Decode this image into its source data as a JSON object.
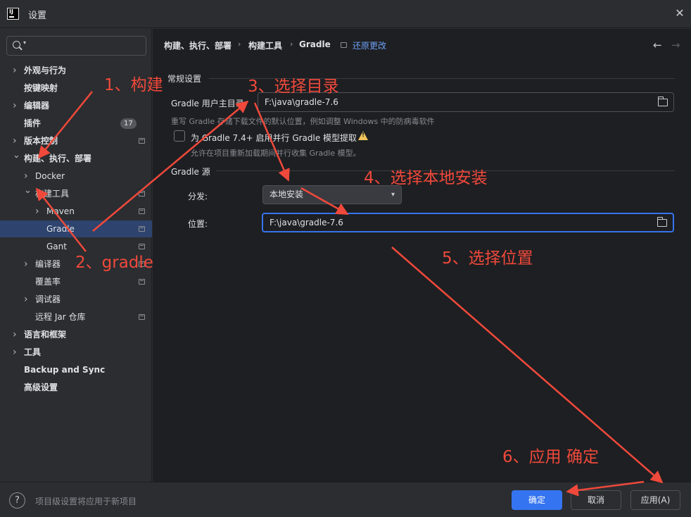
{
  "window": {
    "title": "设置",
    "app_icon_text": "IJ"
  },
  "sidebar": {
    "search": {
      "value": "",
      "placeholder": ""
    },
    "items": [
      {
        "label": "外观与行为",
        "level": 0,
        "chevron": "right",
        "bold": true,
        "proj_icon": false
      },
      {
        "label": "按键映射",
        "level": 0,
        "chevron": "none",
        "bold": true,
        "proj_icon": false
      },
      {
        "label": "编辑器",
        "level": 0,
        "chevron": "right",
        "bold": true,
        "proj_icon": false
      },
      {
        "label": "插件",
        "level": 0,
        "chevron": "none",
        "bold": true,
        "badge": "17"
      },
      {
        "label": "版本控制",
        "level": 0,
        "chevron": "right",
        "bold": true,
        "proj_icon": true
      },
      {
        "label": "构建、执行、部署",
        "level": 0,
        "chevron": "down",
        "bold": true,
        "proj_icon": false
      },
      {
        "label": "Docker",
        "level": 1,
        "chevron": "right",
        "bold": false,
        "proj_icon": false
      },
      {
        "label": "构建工具",
        "level": 1,
        "chevron": "down",
        "bold": false,
        "proj_icon": true
      },
      {
        "label": "Maven",
        "level": 2,
        "chevron": "right",
        "bold": false,
        "proj_icon": true
      },
      {
        "label": "Gradle",
        "level": 3,
        "chevron": "none",
        "bold": false,
        "proj_icon": true,
        "selected": true
      },
      {
        "label": "Gant",
        "level": 3,
        "chevron": "none",
        "bold": false,
        "proj_icon": true
      },
      {
        "label": "编译器",
        "level": 1,
        "chevron": "right",
        "bold": false,
        "proj_icon": true
      },
      {
        "label": "覆盖率",
        "level": 1.5,
        "chevron": "none",
        "bold": false,
        "proj_icon": true
      },
      {
        "label": "调试器",
        "level": 1,
        "chevron": "right",
        "bold": false,
        "proj_icon": false
      },
      {
        "label": "远程 Jar 仓库",
        "level": 1.5,
        "chevron": "none",
        "bold": false,
        "proj_icon": true
      },
      {
        "label": "语言和框架",
        "level": 0,
        "chevron": "right",
        "bold": true,
        "proj_icon": false
      },
      {
        "label": "工具",
        "level": 0,
        "chevron": "right",
        "bold": true,
        "proj_icon": false
      },
      {
        "label": "Backup and Sync",
        "level": 0,
        "chevron": "none",
        "bold": true,
        "proj_icon": false
      },
      {
        "label": "高级设置",
        "level": 0,
        "chevron": "none",
        "bold": true,
        "proj_icon": false
      }
    ]
  },
  "breadcrumb": {
    "items": [
      "构建、执行、部署",
      "构建工具",
      "Gradle"
    ],
    "separator": "›",
    "revert_label": "还原更改"
  },
  "nav": {
    "back": "←",
    "forward": "→"
  },
  "general": {
    "section_title": "常规设置",
    "user_home_label": "Gradle 用户主目录:",
    "user_home_value": "F:\\java\\gradle-7.6",
    "user_home_hint": "重写 Gradle 存储下载文件的默认位置，例如调整 Windows 中的防病毒软件",
    "parallel_label": "为 Gradle 7.4+ 启用并行 Gradle 模型提取",
    "parallel_checked": false,
    "parallel_hint": "允许在项目重新加载期间并行收集 Gradle 模型。"
  },
  "source": {
    "section_title": "Gradle 源",
    "distribution_label": "分发:",
    "distribution_value": "本地安装",
    "location_label": "位置:",
    "location_value": "F:\\java\\gradle-7.6"
  },
  "footer": {
    "help_symbol": "?",
    "note": "项目级设置将应用于新项目",
    "ok_label": "确定",
    "cancel_label": "取消",
    "apply_label": "应用(A)"
  },
  "annotations": {
    "color": "#f0493b",
    "step1": "1、构建",
    "step2": "2、gradle",
    "step3": "3、选择目录",
    "step4": "4、选择本地安装",
    "step5": "5、选择位置",
    "step6": "6、应用 确定"
  },
  "colors": {
    "accent": "#3574f0",
    "selection": "#2e436e",
    "link": "#6ea0f5",
    "warning": "#f2c55c"
  }
}
